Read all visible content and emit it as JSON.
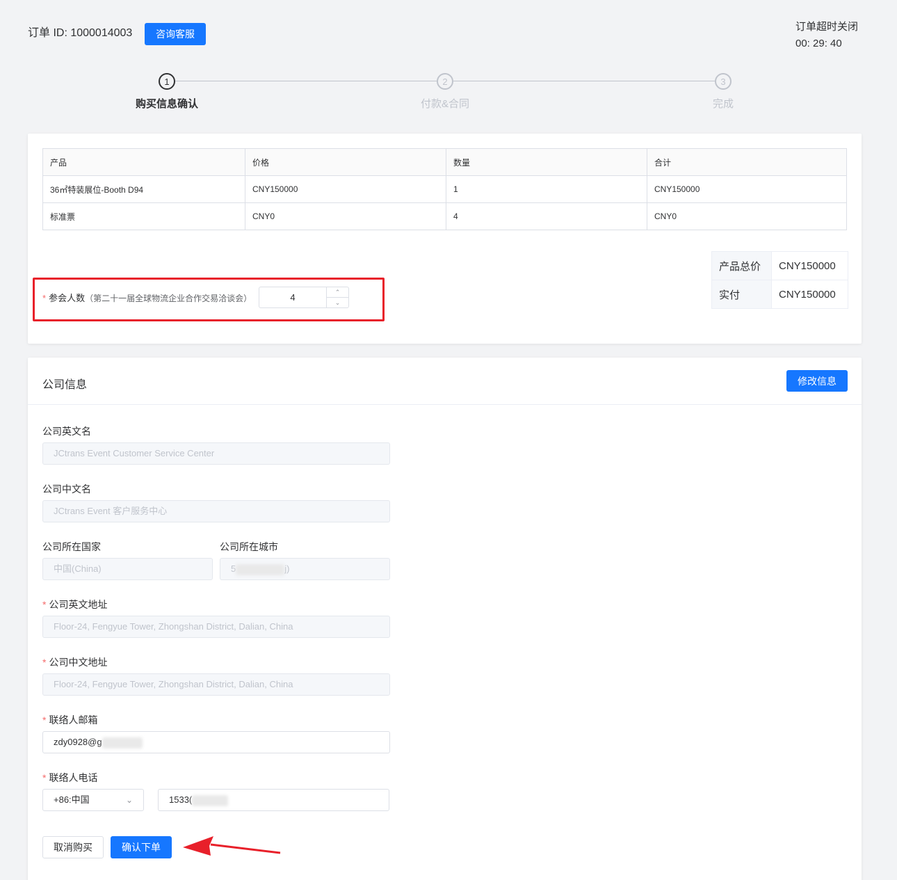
{
  "header": {
    "order_id_label": "订单 ID: 1000014003",
    "consult_button": "咨询客服",
    "timeout_label": "订单超时关闭",
    "timeout_value": "00: 29: 40"
  },
  "steps": [
    {
      "number": "1",
      "label": "购买信息确认"
    },
    {
      "number": "2",
      "label": "付款&合同"
    },
    {
      "number": "3",
      "label": "完成"
    }
  ],
  "products": {
    "headers": [
      "产品",
      "价格",
      "数量",
      "合计"
    ],
    "rows": [
      [
        "36㎡特装展位-Booth D94",
        "CNY150000",
        "1",
        "CNY150000"
      ],
      [
        "标准票",
        "CNY0",
        "4",
        "CNY0"
      ]
    ]
  },
  "totals": {
    "total_label": "产品总价",
    "total_value": "CNY150000",
    "paid_label": "实付",
    "paid_value": "CNY150000"
  },
  "attendees": {
    "required_mark": "*",
    "label": "参会人数",
    "note": "（第二十一届全球物流企业合作交易洽谈会）",
    "value": "4"
  },
  "company": {
    "title": "公司信息",
    "edit_button": "修改信息",
    "en_name_label": "公司英文名",
    "en_name_value": "JCtrans Event Customer Service Center",
    "cn_name_label": "公司中文名",
    "cn_name_value": "JCtrans Event 客户服务中心",
    "country_label": "公司所在国家",
    "country_value": "中国(China)",
    "city_label": "公司所在城市",
    "city_value_start": "5",
    "city_value_end": "j)",
    "en_address_label": "公司英文地址",
    "en_address_value": "Floor-24, Fengyue Tower, Zhongshan District, Dalian, China",
    "cn_address_label": "公司中文地址",
    "cn_address_value": "Floor-24, Fengyue Tower, Zhongshan District, Dalian, China",
    "email_label": "联络人邮箱",
    "email_value": "zdy0928@g",
    "phone_label": "联络人电话",
    "phone_code": "+86:中国",
    "phone_value": "1533("
  },
  "actions": {
    "cancel_button": "取消购买",
    "confirm_button": "确认下单"
  },
  "colors": {
    "primary": "#1677ff",
    "highlight_box": "#e8202a",
    "required": "#f56c6c"
  }
}
